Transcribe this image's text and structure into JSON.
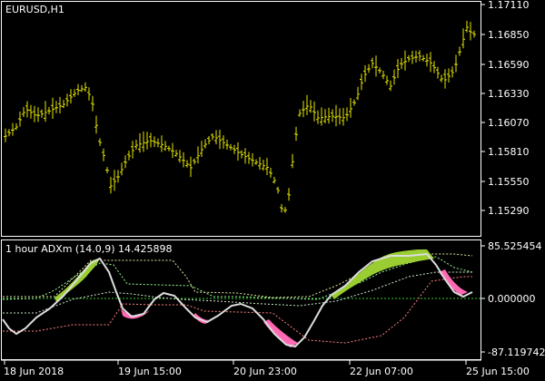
{
  "window": {
    "symbol_label": "EURUSD,H1"
  },
  "main_chart": {
    "price_ticks": [
      "1.17110",
      "1.16850",
      "1.16590",
      "1.16330",
      "1.16070",
      "1.15810",
      "1.15550",
      "1.15290"
    ],
    "bar_color": "#e6e600"
  },
  "indicator": {
    "title": "1 hour ADXm (14.0,9) 14.425898",
    "ticks": [
      "85.525454",
      "0.000000",
      "-87.119742"
    ],
    "colors": {
      "rising": "#9acd32",
      "falling": "#ff69b4",
      "main_line": "#dcdcdc",
      "signal_up": "#98fb98",
      "signal_down": "#ff7f7f",
      "zero_line": "#32cd32"
    }
  },
  "time_axis": {
    "labels": [
      "18 Jun 2018",
      "19 Jun 15:00",
      "20 Jun 23:00",
      "22 Jun 07:00",
      "25 Jun 15:00"
    ]
  },
  "chart_data": {
    "type": "line",
    "title": "",
    "price": {
      "x": [
        "18 Jun 2018",
        "19 Jun 15:00",
        "20 Jun 23:00",
        "22 Jun 07:00",
        "25 Jun 15:00"
      ],
      "close": [
        1.1605,
        1.1602,
        1.155,
        1.1668,
        1.169
      ],
      "ylim": [
        1.151,
        1.1724
      ]
    },
    "adx": {
      "ylim": [
        -87.119742,
        85.525454
      ],
      "zero": 0.0,
      "series": [
        {
          "name": "ADXm",
          "values": [
            -30,
            -45,
            -20,
            10,
            40,
            75,
            30,
            -35,
            -30,
            10,
            30,
            -20,
            -40,
            -25,
            -10,
            -30,
            -50,
            -60,
            -40,
            -10,
            10,
            50,
            60,
            70,
            75,
            78,
            82,
            55,
            20,
            5,
            10
          ]
        }
      ]
    }
  }
}
